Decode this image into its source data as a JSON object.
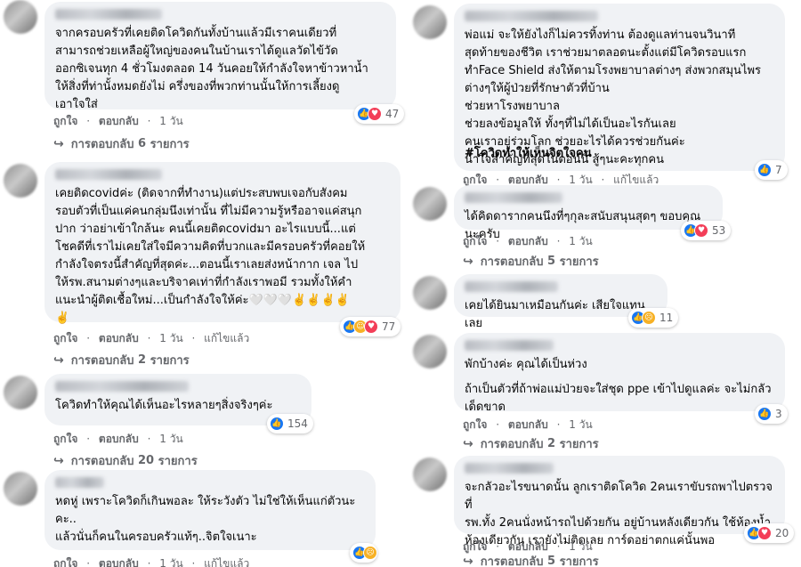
{
  "common": {
    "like": "ถูกใจ",
    "reply": "ตอบกลับ",
    "time": "1 วัน",
    "edited": "แก้ไขแล้ว",
    "dot": "·",
    "replies_prefix": "การตอบกลับ",
    "replies_unit": "รายการ",
    "arrow": "↪"
  },
  "icons": {
    "like": "like-icon",
    "love": "love-icon",
    "care": "care-icon",
    "sad": "sad-icon"
  },
  "colors": {
    "bubble": "#f0f2f5",
    "like": "#1877f2",
    "love": "#f33e58",
    "care": "#f7b125",
    "meta": "#65676b"
  },
  "left": [
    {
      "lines": [
        "จากครอบครัวที่เคยติดโควิดกันทั้งบ้านแล้วมีเราคนเดียวที่",
        "สามารถช่วยเหลือผู้ใหญ่ของคนในบ้านเราได้ดูแลวัดไข้วัด",
        "ออกซิเจนทุก 4 ชั่วโมงตลอด 14 วันคอยให้กำลังใจหาข้าวหาน้ำ",
        "ให้สิ่งที่ท่านั้งหมดยังไม่ ครึ่งของที่พวกท่านนั้นให้การเลี้ยงดู",
        "เอาใจใส่"
      ],
      "reaction_count": "47",
      "edited": false,
      "replies_count": "6"
    },
    {
      "lines": [
        "เคยติดcovidค่ะ (ติดจากที่ทำงาน)แต่ประสบพบเจอกับสังคม",
        "รอบตัวที่เป็นแค่คนกลุ่มนึงเท่านั้น ที่ไม่มีความรู้หรืออาจแค่สนุก",
        "ปาก ว่าอย่าเข้าใกล้นะ คนนี้เคยติดcovidมา อะไรแบบนี้...แต่",
        "โชคดีที่เราไม่เคยใส่ใจมีความคิดที่บวกและมีครอบครัวที่คอยให้",
        "กำลังใจตรงนี้สำคัญที่สุดค่ะ...ตอนนี้เราเลยส่งหน้ากาก เจล ไป",
        "ให้รพ.สนามต่างๆและบริจาคเท่าที่กำลังเราพอมี รวมทั้งให้คำ",
        "แนะนำผู้ติดเชื้อใหม่...เป็นกำลังใจให้ค่ะ🤍🤍🤍✌️✌️✌️✌️",
        "✌️"
      ],
      "reaction_count": "77",
      "edited": true,
      "replies_count": "2"
    },
    {
      "lines": [
        "โควิดทำให้คุณได้เห็นอะไรหลายๆสิ่งจริงๆค่ะ"
      ],
      "reaction_count": "154",
      "edited": false,
      "replies_count": "20"
    },
    {
      "lines": [
        "หดหู่ เพราะโควิดก็เกินพอละ ให้ระวังตัว ไม่ใช่ให้เห็นแก่ตัวนะ",
        "คะ..",
        "แล้วนั่นก็คนในครอบครัวแท้ๆ..จิตใจเนาะ"
      ],
      "reaction_count": "",
      "edited": true,
      "replies_count": ""
    }
  ],
  "right": [
    {
      "lines": [
        "พ่อแม่ จะให้ยังไงก็ไม่ควรทิ้งท่าน ต้องดูแลท่านจนวินาที",
        "สุดท้ายของชีวิต เราช่วยมาตลอดนะตั้งแต่มีโควิดรอบแรก",
        "ทำFace Shield ส่งให้ตามโรงพยาบาลต่างๆ ส่งพวกสมุนไพร",
        "ต่างๆให้ผู้ป่วยที่รักษาตัวที่บ้าน",
        "ช่วยหาโรงพยาบาล",
        "ช่วยลงข้อมูลให้ ทั้งๆที่ไม่ได้เป็นอะไรกันเลย",
        "คนเราอยู่ร่วมโลก ช่วยอะไรได้ควรช่วยกันค่ะ",
        "น้ำใจสำคัญที่สุดในตอนนี้ สู้ๆนะคะทุกคน"
      ],
      "hashtag": "#โควิดทำให้เห็นจิตใจคน",
      "reaction_count": "7",
      "edited": true,
      "replies_count": ""
    },
    {
      "lines": [
        "ได้คิดดารากคนนึงที่ๆกุละสนับสนุนสุดๆ ขอบคุณนะครับ"
      ],
      "reaction_count": "53",
      "edited": false,
      "replies_count": "5"
    },
    {
      "lines": [
        "เคยได้ยินมาเหมือนกันค่ะ เสียใจแทนเลย"
      ],
      "reaction_count": "11",
      "edited": false,
      "replies_count": ""
    },
    {
      "lines": [
        "พักบ้างค่ะ คุณได้เป็นห่วง",
        "",
        "ถ้าเป็นตัวที่ถ้าพ่อแม่ป่วยจะใส่ชุด ppe เข้าไปดูแลค่ะ จะไม่กลัว",
        "เด็ดขาด"
      ],
      "reaction_count": "3",
      "edited": false,
      "replies_count": "2"
    },
    {
      "lines": [
        "จะกลัวอะไรขนาดนั้น ลูกเราติดโควิด 2คนเราขับรถพาไปตรวจที่",
        "รพ.ทั้ง 2คนนั่งหน้ารถไปด้วยกัน อยู่บ้านหลังเดียวกัน ใช้ห้องน้ำ",
        "ห้องเดียวกัน เรายังไม่ติดเลย การ์ดอย่าตกแค่นั้นพอ"
      ],
      "reaction_count": "20",
      "edited": false,
      "replies_count": "5"
    }
  ]
}
